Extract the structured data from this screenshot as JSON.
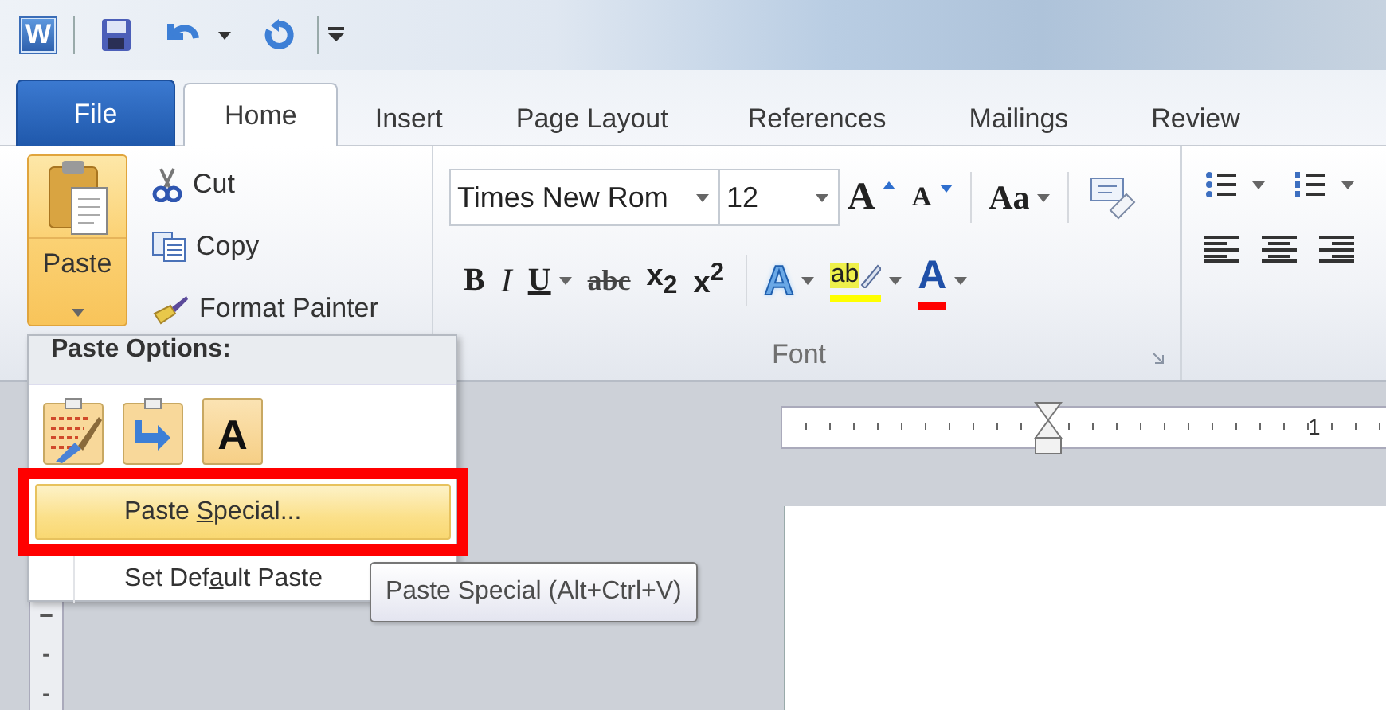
{
  "title_bar": {
    "app_letter": "W"
  },
  "tabs": [
    {
      "label": "File",
      "kind": "backstage",
      "selected": false
    },
    {
      "label": "Home",
      "kind": "tab",
      "selected": true
    },
    {
      "label": "Insert",
      "kind": "tab",
      "selected": false
    },
    {
      "label": "Page Layout",
      "kind": "tab",
      "selected": false
    },
    {
      "label": "References",
      "kind": "tab",
      "selected": false
    },
    {
      "label": "Mailings",
      "kind": "tab",
      "selected": false
    },
    {
      "label": "Review",
      "kind": "tab",
      "selected": false
    }
  ],
  "clipboard": {
    "paste": {
      "label": "Paste",
      "pressed": true
    },
    "commands": [
      {
        "label": "Cut",
        "kind": "cut"
      },
      {
        "label": "Copy",
        "kind": "copy"
      },
      {
        "label": "Format Painter",
        "kind": "format_painter"
      }
    ]
  },
  "font_group": {
    "label": "Font",
    "font_name": "Times New Rom",
    "font_size": "12",
    "size_tools": [
      {
        "kind": "grow",
        "glyph": "A"
      },
      {
        "kind": "shrink",
        "glyph": "A"
      },
      {
        "kind": "case",
        "glyph": "Aa"
      },
      {
        "kind": "clear"
      }
    ],
    "format_tools": [
      {
        "kind": "bold",
        "glyph": "B"
      },
      {
        "kind": "italic",
        "glyph": "I"
      },
      {
        "kind": "underline",
        "glyph": "U"
      },
      {
        "kind": "strike",
        "glyph": "abc"
      },
      {
        "kind": "subscript",
        "glyph": "x$_{2}$"
      },
      {
        "kind": "superscript",
        "glyph": "x$^{2}$"
      },
      {
        "kind": "effects",
        "glyph": "A"
      },
      {
        "kind": "highlight",
        "glyph": "ab",
        "color": "#ffff00"
      },
      {
        "kind": "font_color",
        "glyph": "A",
        "color": "#ff0000"
      }
    ]
  },
  "ruler": {
    "mark": "1"
  },
  "paste_menu": {
    "title": "Paste Options:",
    "options": [
      {
        "kind": "keep_source"
      },
      {
        "kind": "merge"
      },
      {
        "kind": "text_only",
        "glyph": "A"
      }
    ],
    "items": [
      {
        "label_parts": [
          "Paste ",
          "S",
          "pecial..."
        ],
        "selected": true,
        "framed": true
      },
      {
        "label_parts": [
          "Set Def",
          "a",
          "ult Paste"
        ],
        "selected": false,
        "framed": false
      }
    ],
    "tooltip": "Paste Special (Alt+Ctrl+V)"
  }
}
